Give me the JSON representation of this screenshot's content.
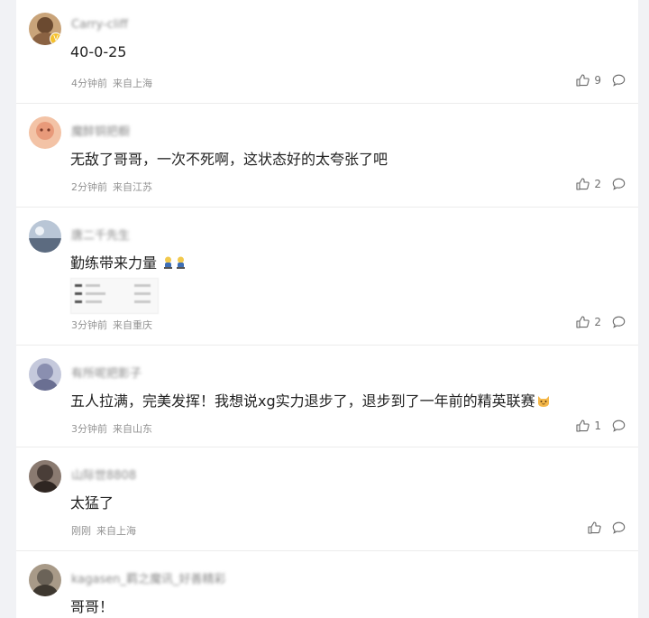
{
  "comments": [
    {
      "username": "Carry-cliff",
      "content": "40-0-25",
      "time": "4分钟前",
      "location": "来自上海",
      "likes": "9",
      "avatar_color": "#8a6242",
      "verified": true
    },
    {
      "username": "魔醉铜把橱",
      "content": "无敌了哥哥，一次不死啊，这状态好的太夸张了吧",
      "time": "2分钟前",
      "location": "来自江苏",
      "likes": "2",
      "avatar_color": "#e89a7a"
    },
    {
      "username": "唐二千先生",
      "content": "勤练带来力量",
      "time": "3分钟前",
      "location": "来自重庆",
      "likes": "2",
      "avatar_color": "#7b8aa0",
      "emoji": [
        "strong-arm-emoji",
        "strong-arm-emoji"
      ],
      "has_image": true
    },
    {
      "username": "有所呢把影子",
      "content": "五人拉满，完美发挥！我想说xg实力退步了，退步到了一年前的精英联赛",
      "time": "3分钟前",
      "location": "来自山东",
      "likes": "1",
      "avatar_color": "#8a8fb0",
      "emoji": [
        "cat-emoji"
      ]
    },
    {
      "username": "山际世8808",
      "content": "太猛了",
      "time": "刚刚",
      "location": "来自上海",
      "likes": "",
      "avatar_color": "#4a3e38"
    },
    {
      "username": "kagasen_羁之魔讯_好善精彩",
      "content": "哥哥！",
      "avatar_color": "#6b6358"
    }
  ]
}
